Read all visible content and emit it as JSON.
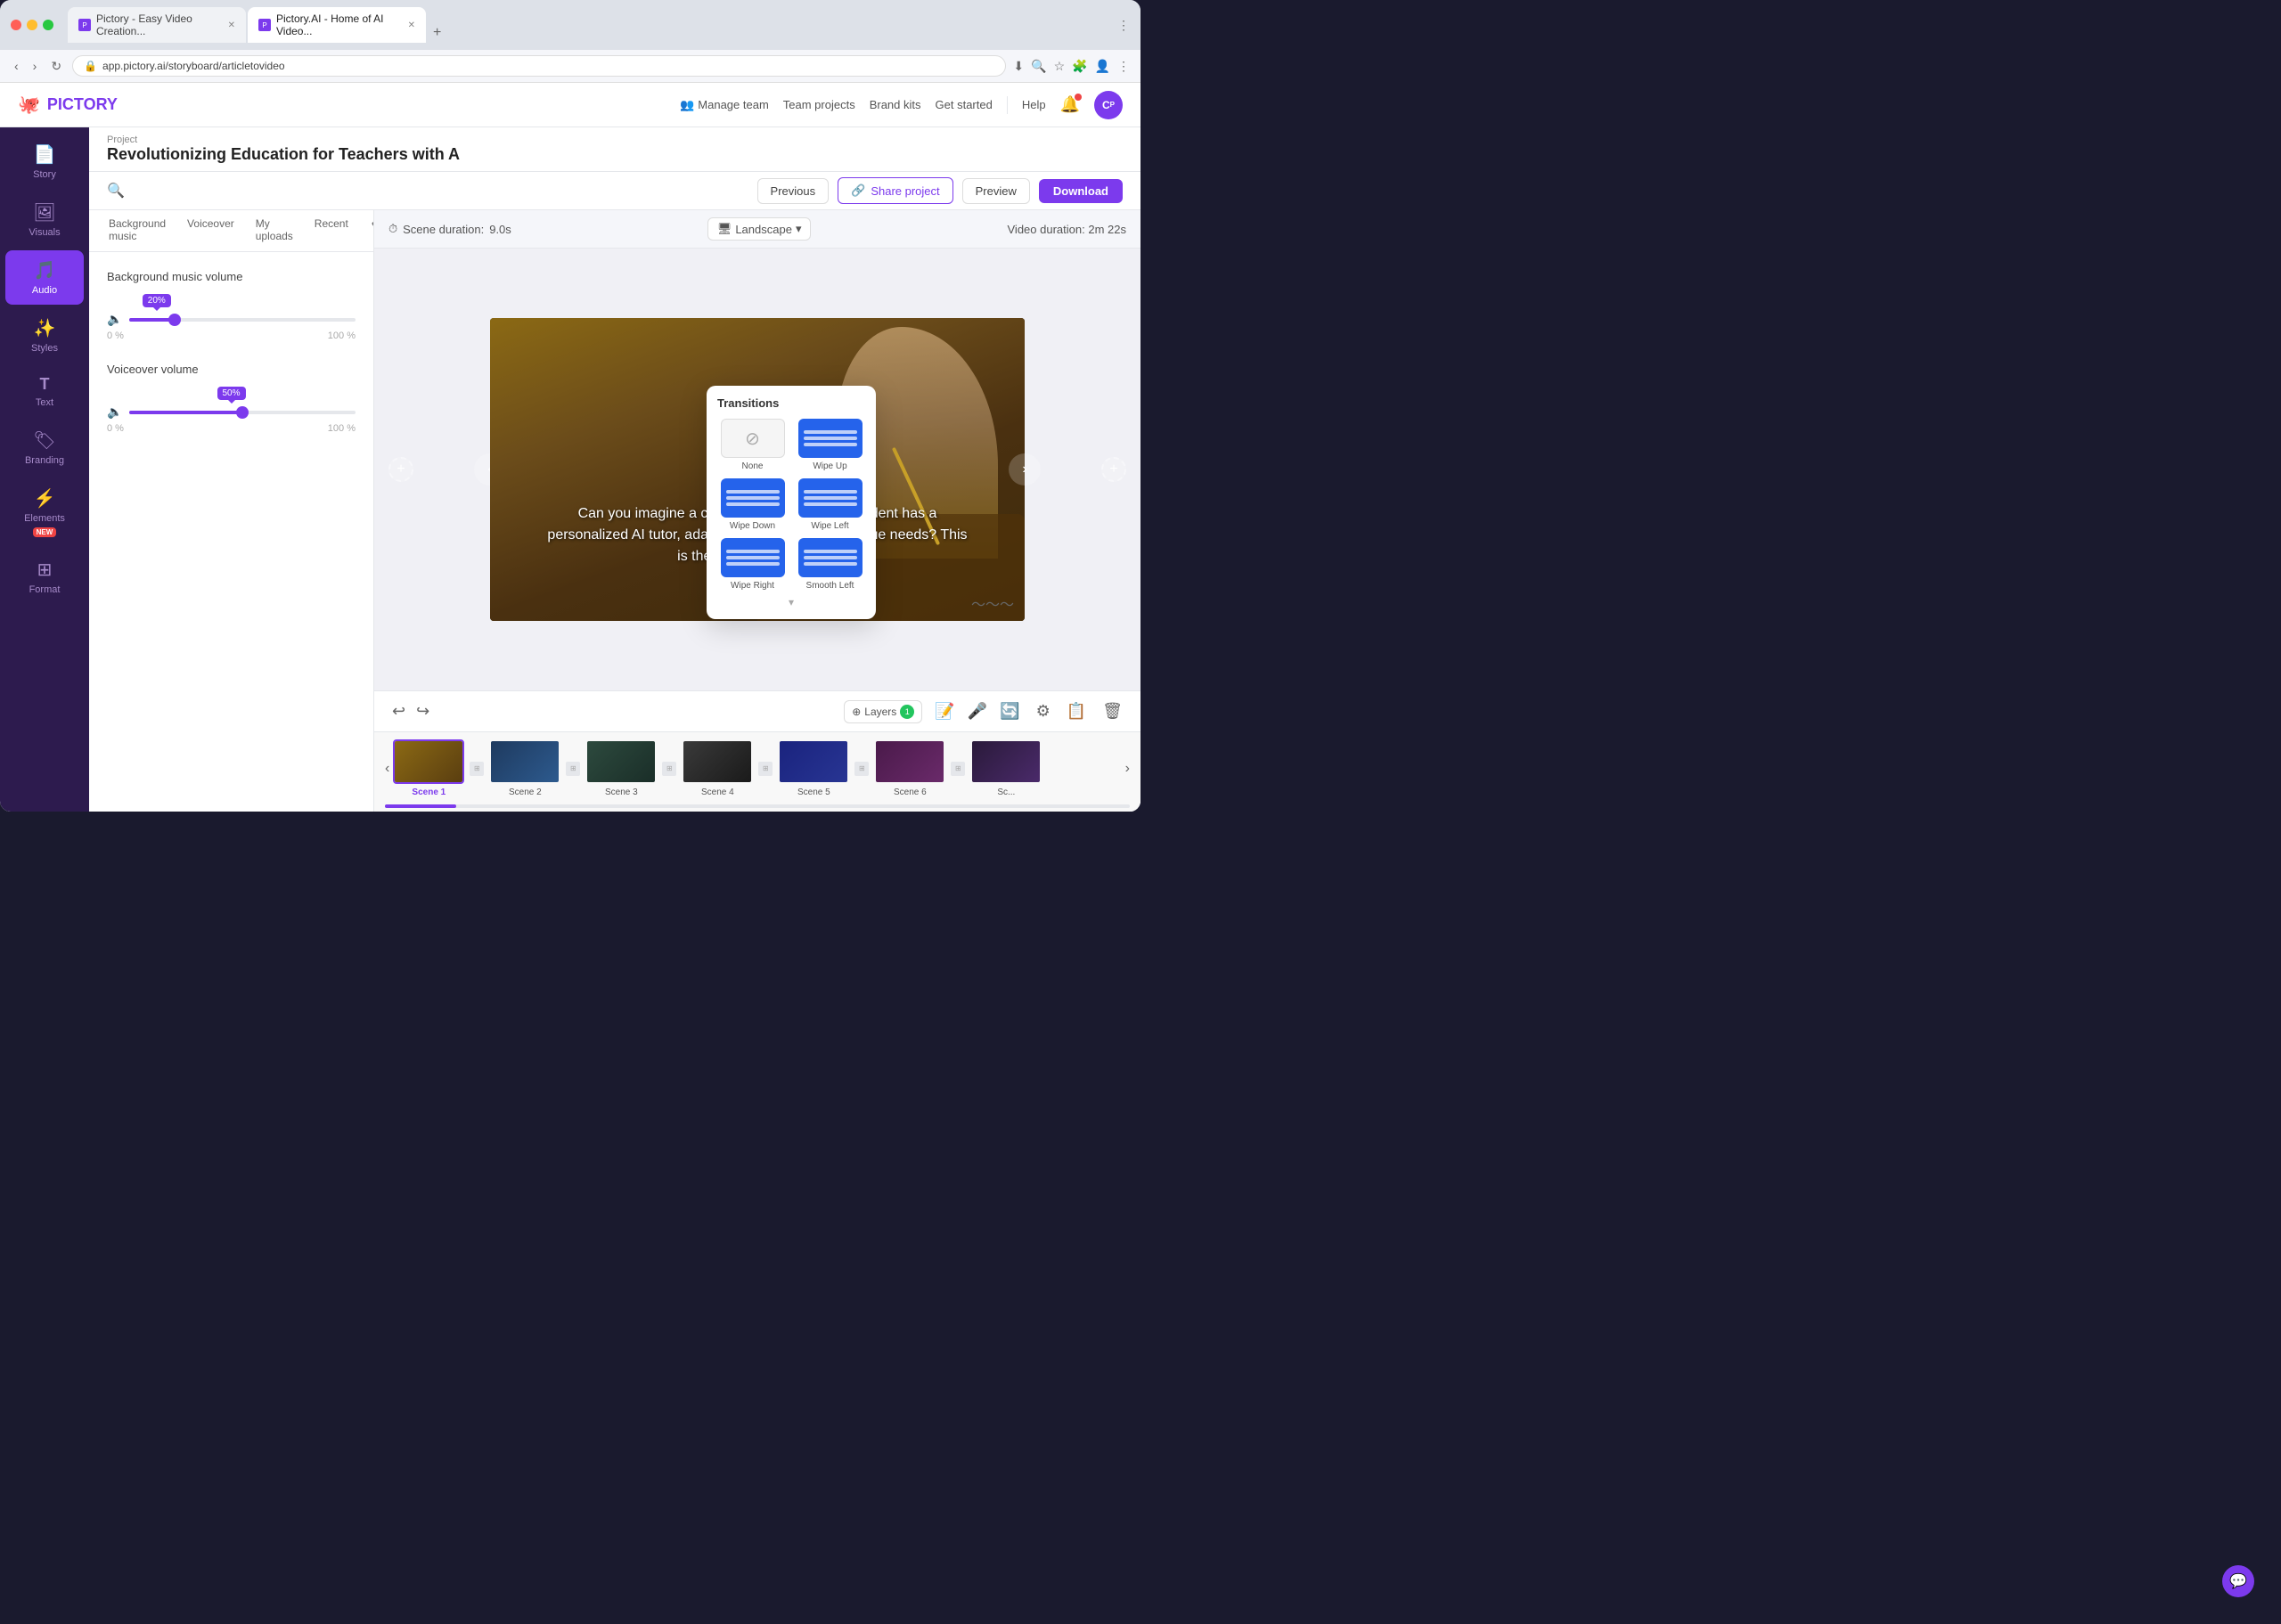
{
  "browser": {
    "url": "app.pictory.ai/storyboard/articletovideo",
    "tabs": [
      {
        "label": "Pictory - Easy Video Creation...",
        "active": false
      },
      {
        "label": "Pictory.AI - Home of AI Video...",
        "active": true
      }
    ],
    "tab_add": "+",
    "nav_back": "‹",
    "nav_forward": "›",
    "nav_refresh": "↻"
  },
  "header": {
    "logo_text": "PICTORY",
    "manage_team": "Manage team",
    "team_projects": "Team projects",
    "brand_kits": "Brand kits",
    "get_started": "Get started",
    "help": "Help"
  },
  "project": {
    "label": "Project",
    "title": "Revolutionizing Education for Teachers with A",
    "previous_btn": "Previous",
    "share_btn": "Share project",
    "preview_btn": "Preview",
    "download_btn": "Download"
  },
  "panel_tabs": {
    "items": [
      {
        "label": "Background music",
        "active": false
      },
      {
        "label": "Voiceover",
        "active": false
      },
      {
        "label": "My uploads",
        "active": false
      },
      {
        "label": "Recent",
        "active": false
      }
    ]
  },
  "audio": {
    "bg_volume_label": "Background music volume",
    "bg_volume_value": 20,
    "bg_volume_tooltip": "20%",
    "bg_volume_min": "0 %",
    "bg_volume_max": "100 %",
    "vo_volume_label": "Voiceover volume",
    "vo_volume_value": 50,
    "vo_volume_tooltip": "50%",
    "vo_volume_min": "0 %",
    "vo_volume_max": "100 %"
  },
  "preview": {
    "scene_duration_label": "Scene duration:",
    "scene_duration_value": "9.0s",
    "landscape_label": "Landscape",
    "video_duration_label": "Video duration:",
    "video_duration_value": "2m 22s",
    "video_text": "Can you imagine a classroom where every student has a personalized AI tutor, adapting lessons to their unique needs? This is the future of education."
  },
  "transitions": {
    "title": "Transitions",
    "items": [
      {
        "label": "None",
        "type": "none"
      },
      {
        "label": "Wipe Up",
        "type": "blue"
      },
      {
        "label": "Wipe Down",
        "type": "blue"
      },
      {
        "label": "Wipe Left",
        "type": "blue"
      },
      {
        "label": "Wipe Right",
        "type": "blue"
      },
      {
        "label": "Smooth Left",
        "type": "blue"
      }
    ]
  },
  "bottom_toolbar": {
    "layers_label": "Layers",
    "undo": "↩",
    "redo": "↪"
  },
  "timeline": {
    "scenes": [
      {
        "label": "Scene 1",
        "active": true,
        "bg": "scene-bg-1"
      },
      {
        "label": "Scene 2",
        "active": false,
        "bg": "scene-bg-2"
      },
      {
        "label": "Scene 3",
        "active": false,
        "bg": "scene-bg-3"
      },
      {
        "label": "Scene 4",
        "active": false,
        "bg": "scene-bg-4"
      },
      {
        "label": "Scene 5",
        "active": false,
        "bg": "scene-bg-5"
      },
      {
        "label": "Scene 6",
        "active": false,
        "bg": "scene-bg-6"
      },
      {
        "label": "Sc...",
        "active": false,
        "bg": "scene-bg-7"
      }
    ]
  },
  "sidebar": {
    "items": [
      {
        "id": "story",
        "label": "Story",
        "icon": "📄",
        "active": false
      },
      {
        "id": "visuals",
        "label": "Visuals",
        "icon": "🖼",
        "active": false
      },
      {
        "id": "audio",
        "label": "Audio",
        "icon": "🎵",
        "active": true
      },
      {
        "id": "styles",
        "label": "Styles",
        "icon": "✨",
        "active": false
      },
      {
        "id": "text",
        "label": "Text",
        "icon": "T",
        "active": false
      },
      {
        "id": "branding",
        "label": "Branding",
        "icon": "🏷",
        "active": false,
        "badge": ""
      },
      {
        "id": "elements",
        "label": "Elements",
        "icon": "⚡",
        "active": false,
        "badge": "NEW"
      },
      {
        "id": "format",
        "label": "Format",
        "icon": "⊞",
        "active": false
      }
    ]
  }
}
